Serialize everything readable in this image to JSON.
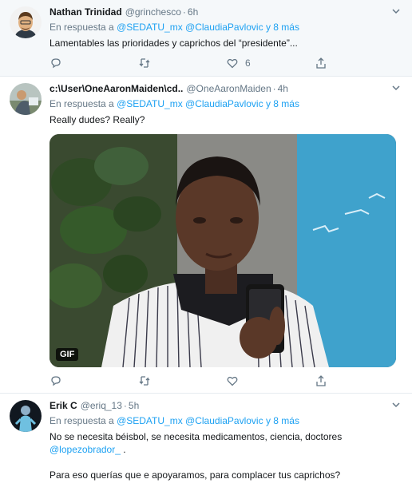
{
  "tweets": [
    {
      "name": "Nathan Trinidad",
      "handle": "@grinchesco",
      "time": "6h",
      "reply_prefix": "En respuesta a",
      "reply_mentions": "@SEDATU_mx @ClaudiaPavlovic",
      "reply_suffix": "y 8 más",
      "text": "Lamentables las prioridades y caprichos del “presidente”...",
      "likes": "6"
    },
    {
      "name": "c:\\User\\OneAaronMaiden\\cd..",
      "handle": "@OneAaronMaiden",
      "time": "4h",
      "reply_prefix": "En respuesta a",
      "reply_mentions": "@SEDATU_mx @ClaudiaPavlovic",
      "reply_suffix": "y 8 más",
      "text": "Really dudes? Really?",
      "gif_label": "GIF"
    },
    {
      "name": "Erik C",
      "handle": "@eriq_13",
      "time": "5h",
      "reply_prefix": "En respuesta a",
      "reply_mentions": "@SEDATU_mx @ClaudiaPavlovic",
      "reply_suffix": "y 8 más",
      "text_line1": "No se necesita béisbol, se necesita medicamentos, ciencia, doctores",
      "text_mention": "@lopezobrador_",
      "text_mention_suffix": " .",
      "text_line2": "Para eso querías que e apoyaramos, para complacer tus caprichos?"
    }
  ],
  "separator": "·",
  "icons": [
    "reply-icon",
    "retweet-icon",
    "like-icon",
    "share-icon",
    "caret-down-icon"
  ],
  "colors": {
    "link": "#1da1f2",
    "muted": "#657786",
    "highlight_bg": "#f5f8fa"
  }
}
